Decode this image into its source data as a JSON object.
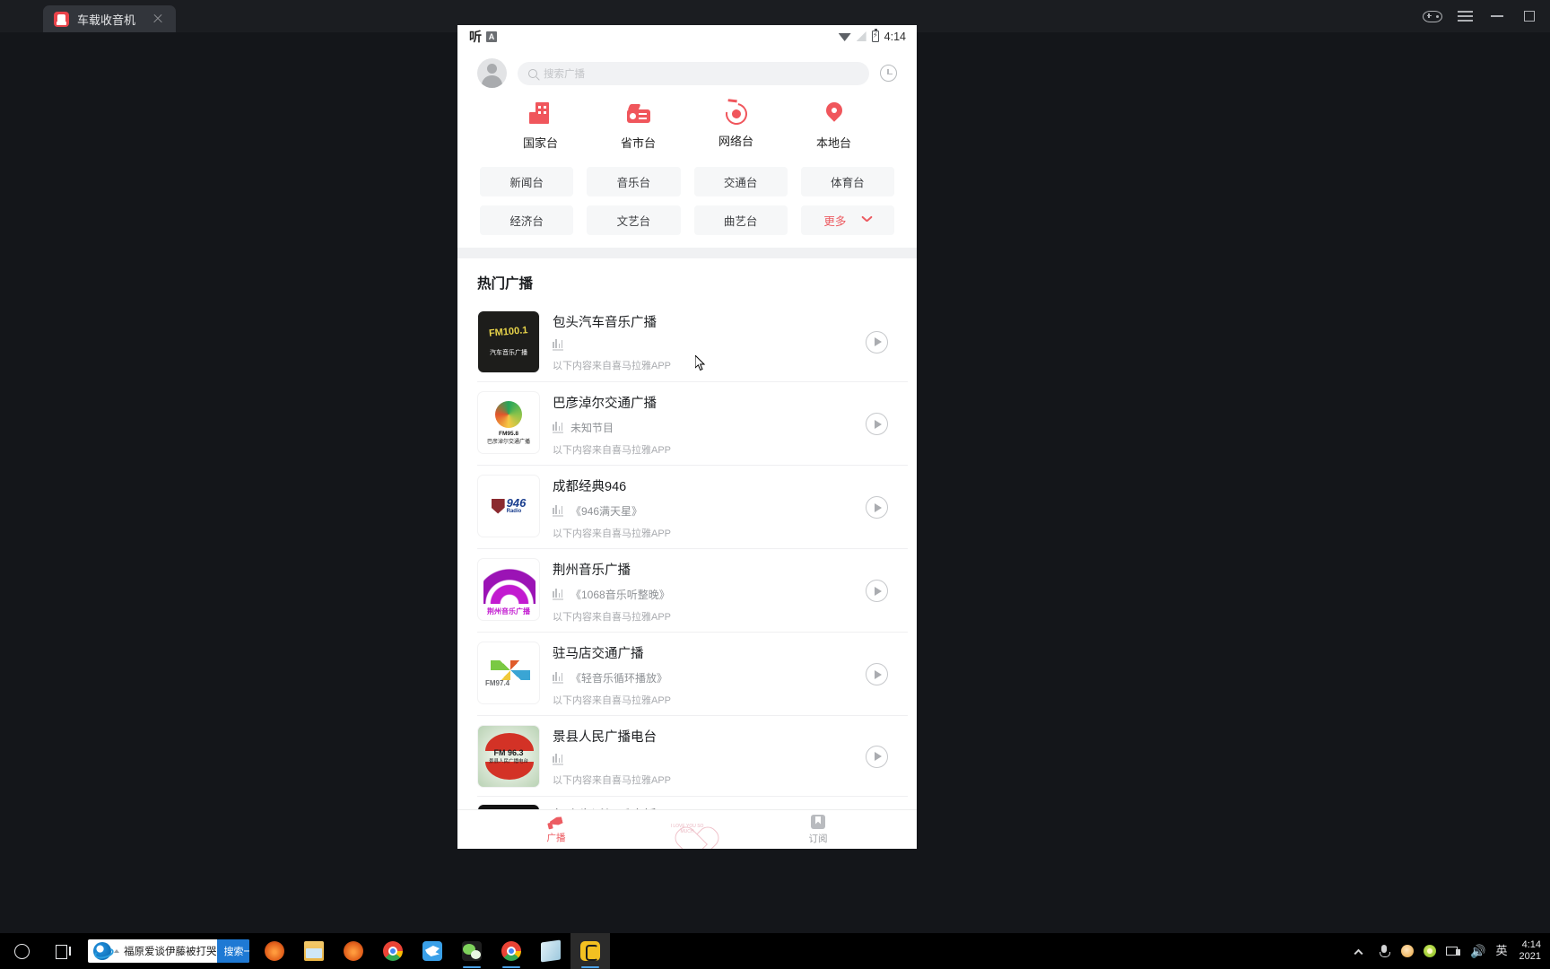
{
  "window": {
    "tab_title": "车载收音机",
    "controls": [
      "gamepad",
      "menu",
      "minimize",
      "maximize"
    ]
  },
  "phone": {
    "status_bar": {
      "left_label": "听",
      "badge": "A",
      "time": "4:14",
      "icons": [
        "wifi-icon",
        "signal-icon",
        "battery-charging-icon"
      ]
    },
    "search": {
      "placeholder": "搜索广播"
    },
    "categories": [
      {
        "label": "国家台",
        "icon": "building-icon"
      },
      {
        "label": "省市台",
        "icon": "radio-icon"
      },
      {
        "label": "网络台",
        "icon": "network-target-icon"
      },
      {
        "label": "本地台",
        "icon": "location-pin-icon"
      }
    ],
    "chips": [
      {
        "label": "新闻台",
        "more": false
      },
      {
        "label": "音乐台",
        "more": false
      },
      {
        "label": "交通台",
        "more": false
      },
      {
        "label": "体育台",
        "more": false
      },
      {
        "label": "经济台",
        "more": false
      },
      {
        "label": "文艺台",
        "more": false
      },
      {
        "label": "曲艺台",
        "more": false
      },
      {
        "label": "更多",
        "more": true
      }
    ],
    "section_title": "热门广播",
    "source_note": "以下内容来自喜马拉雅APP",
    "stations": [
      {
        "name": "包头汽车音乐广播",
        "program": "",
        "source": "以下内容来自喜马拉雅APP",
        "logo_text": "FM100.1",
        "logo_sub": "汽车音乐广播",
        "logo_bg": "#1d1d1b",
        "logo_fg": "#e8d44a"
      },
      {
        "name": "巴彦淖尔交通广播",
        "program": "未知节目",
        "source": "以下内容来自喜马拉雅APP",
        "logo_text": "FM95.8",
        "logo_sub": "巴彦淖尔交通广播",
        "logo_bg": "#ffffff",
        "logo_fg": "#19a05a"
      },
      {
        "name": "成都经典946",
        "program": "《946满天星》",
        "source": "以下内容来自喜马拉雅APP",
        "logo_text": "946",
        "logo_sub": "Radio",
        "logo_bg": "#ffffff",
        "logo_fg": "#1b3f8f"
      },
      {
        "name": "荆州音乐广播",
        "program": "《1068音乐听整晚》",
        "source": "以下内容来自喜马拉雅APP",
        "logo_text": "",
        "logo_sub": "荆州音乐广播",
        "logo_bg": "#ffffff",
        "logo_fg": "#c21ad0"
      },
      {
        "name": "驻马店交通广播",
        "program": "《轻音乐循环播放》",
        "source": "以下内容来自喜马拉雅APP",
        "logo_text": "FM97.4",
        "logo_sub": "",
        "logo_bg": "#ffffff",
        "logo_fg": "#3aa5d4"
      },
      {
        "name": "景县人民广播电台",
        "program": "",
        "source": "以下内容来自喜马拉雅APP",
        "logo_text": "FM 96.3",
        "logo_sub": "景县人民广播电台",
        "logo_bg": "#cfe3cc",
        "logo_fg": "#d33226"
      },
      {
        "name": "包头生活娱乐广播",
        "program": "",
        "source": "",
        "logo_text": "",
        "logo_sub": "",
        "logo_bg": "#131313",
        "logo_fg": "#f1c824"
      }
    ],
    "bottom_nav": [
      {
        "label": "广播",
        "icon": "megaphone-icon",
        "active": true
      },
      {
        "label": "订阅",
        "icon": "bookmark-icon",
        "active": false
      }
    ],
    "center_button": {
      "icon": "heart-icon",
      "text": "I LOVE YOU SO MUCH"
    }
  },
  "taskbar": {
    "search_query": "福原爱谈伊藤被打哭",
    "search_button": "搜索一下",
    "apps": [
      "folder-icon",
      "firefox-icon",
      "chrome-icon",
      "bird-icon",
      "wechat-icon",
      "chrome-icon",
      "notepad-icon",
      "radio-app-icon"
    ],
    "tray": {
      "ime": "英",
      "time": "4:14",
      "date": "2021"
    }
  },
  "colors": {
    "accent": "#ec5c62",
    "icon_red": "#f0565c",
    "taskbar_blue": "#1e79d4"
  }
}
